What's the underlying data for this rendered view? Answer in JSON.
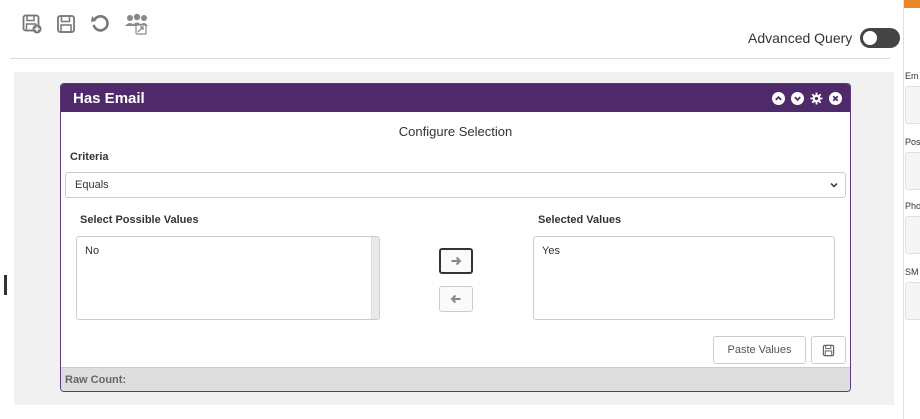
{
  "advanced_query": {
    "label": "Advanced Query",
    "enabled": true
  },
  "panel": {
    "title": "Has Email",
    "config_title": "Configure Selection",
    "criteria_label": "Criteria",
    "criteria_value": "Equals",
    "possible_label": "Select Possible Values",
    "selected_label": "Selected Values",
    "possible_values": [
      "No"
    ],
    "selected_values": [
      "Yes"
    ],
    "paste_label": "Paste Values",
    "footer_label": "Raw Count:"
  },
  "right_panel": {
    "fields": [
      "Em",
      "Pos",
      "Pho",
      "SM"
    ]
  },
  "colors": {
    "panel_header": "#4e2a6b",
    "accent": "#e8892a",
    "toggle": "#444444"
  },
  "icons": {
    "toolbar": [
      "save-add-icon",
      "save-icon",
      "undo-icon",
      "share-users-icon"
    ],
    "panel": [
      "collapse-up-icon",
      "expand-down-icon",
      "gear-icon",
      "close-icon"
    ]
  }
}
